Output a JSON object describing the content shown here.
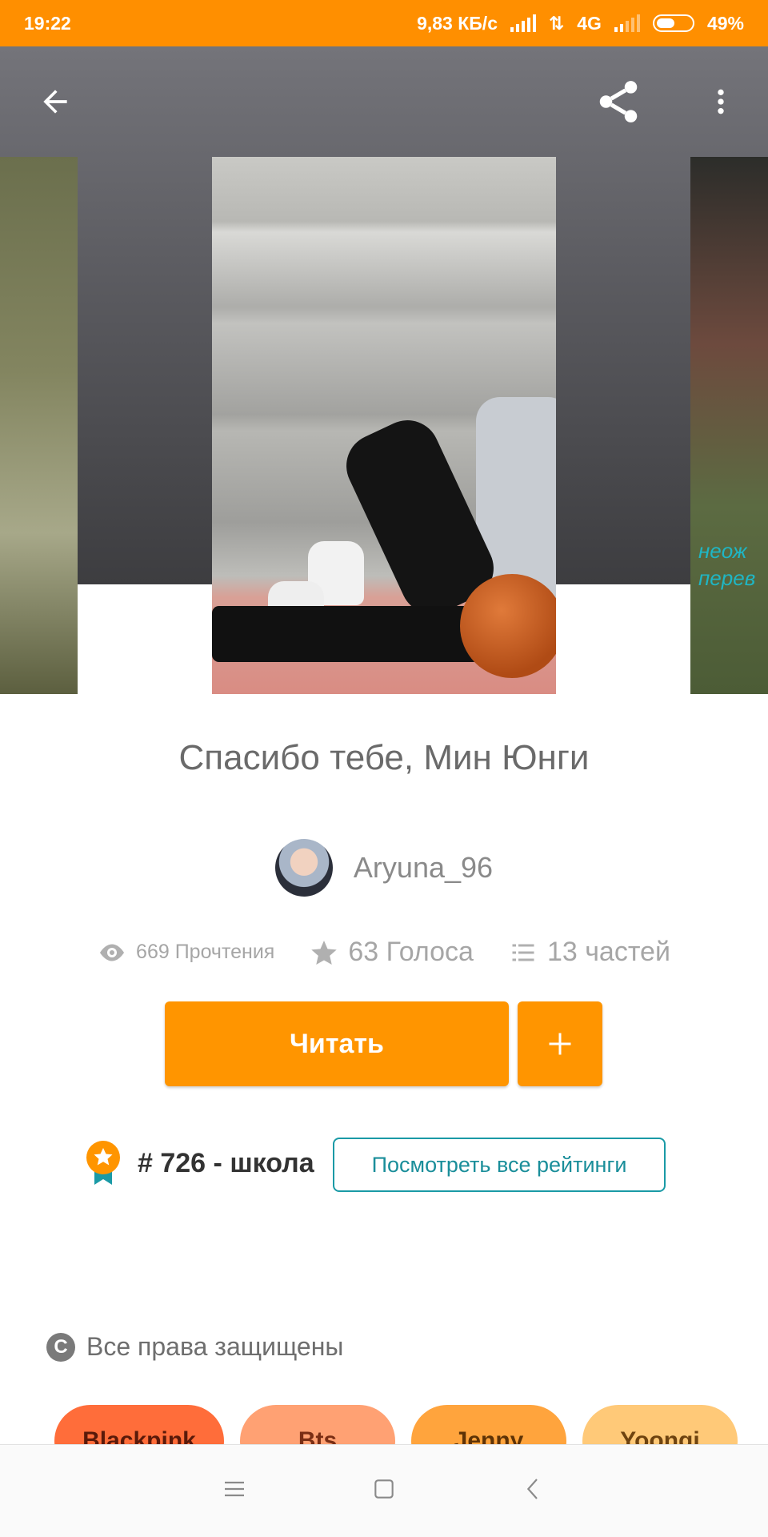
{
  "status_bar": {
    "time": "19:22",
    "speed": "9,83 КБ/с",
    "network": "4G",
    "battery": "49%"
  },
  "toolbar": {
    "back_icon": "arrow-left-icon",
    "share_icon": "share-icon",
    "menu_icon": "more-vert-icon"
  },
  "covers": {
    "right_cover_text": [
      "неож",
      "перев"
    ]
  },
  "story": {
    "title": "Спасибо тебе, Мин Юнги",
    "author": "Aryuna_96"
  },
  "stats": {
    "reads": "669 Прочтения",
    "votes": "63 Голоса",
    "parts": "13 частей"
  },
  "actions": {
    "read_label": "Читать",
    "add_label": "+"
  },
  "ranking": {
    "rank": "# 726",
    "separator": "-",
    "category": "школа",
    "view_all_label": "Посмотреть все рейтинги"
  },
  "copyright": {
    "icon_letter": "C",
    "label": "Все права защищены"
  },
  "tags": [
    {
      "label": "Blackpink",
      "bg": "#ff6d3a",
      "color": "#5a1a0a"
    },
    {
      "label": "Bts",
      "bg": "#ffa173",
      "color": "#7a2e14"
    },
    {
      "label": "Jenny",
      "bg": "#ffa43d",
      "color": "#5e3306"
    },
    {
      "label": "Yoongi",
      "bg": "#ffc978",
      "color": "#6e4310"
    }
  ],
  "colors": {
    "accent": "#ff9500",
    "status_bar": "#ff8f00",
    "link": "#1a9aa6"
  }
}
